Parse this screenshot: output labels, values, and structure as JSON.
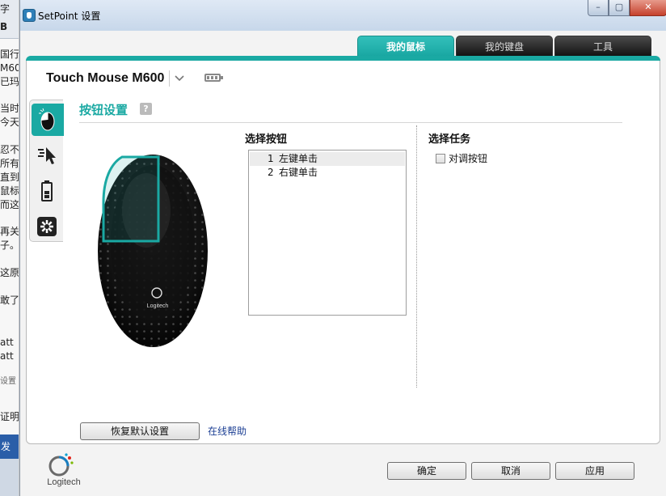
{
  "background_app": {
    "fragments": [
      "字",
      "B",
      "国行",
      "M60",
      "已玛",
      "当时",
      "今天",
      "忍不",
      "所有",
      "直到",
      "鼠标",
      "而这",
      "再关",
      "子。",
      "这原",
      "敢了",
      "att",
      "att",
      "设置",
      "证明",
      "发表"
    ]
  },
  "window": {
    "title": "SetPoint 设置",
    "caption": {
      "minimize": "–",
      "maximize": "▢",
      "close": "✕"
    }
  },
  "tabs": [
    {
      "label": "我的鼠标",
      "active": true
    },
    {
      "label": "我的键盘",
      "active": false
    },
    {
      "label": "工具",
      "active": false
    }
  ],
  "device": {
    "name": "Touch Mouse M600",
    "dropdown_icon": "chevron-down-icon",
    "battery_icon": "battery-icon"
  },
  "side_tabs": [
    {
      "icon": "mouse-buttons-icon",
      "active": true
    },
    {
      "icon": "pointer-speed-icon",
      "active": false
    },
    {
      "icon": "battery-status-icon",
      "active": false
    },
    {
      "icon": "settings-gear-icon",
      "active": false
    }
  ],
  "section": {
    "title": "按钮设置",
    "help_icon": "?"
  },
  "mouse_image": {
    "brand_text": "Logitech"
  },
  "select_button": {
    "title": "选择按钮",
    "items": [
      {
        "num": "1",
        "label": "左键单击",
        "selected": true
      },
      {
        "num": "2",
        "label": "右键单击",
        "selected": false
      }
    ]
  },
  "select_task": {
    "title": "选择任务",
    "checkbox_label": "对调按钮",
    "checked": false
  },
  "footer": {
    "restore_default": "恢复默认设置",
    "online_help": "在线帮助",
    "ok": "确定",
    "cancel": "取消",
    "apply": "应用"
  },
  "logo": {
    "text": "Logitech"
  },
  "colors": {
    "accent": "#1aa9a3",
    "link": "#1c3f94"
  }
}
